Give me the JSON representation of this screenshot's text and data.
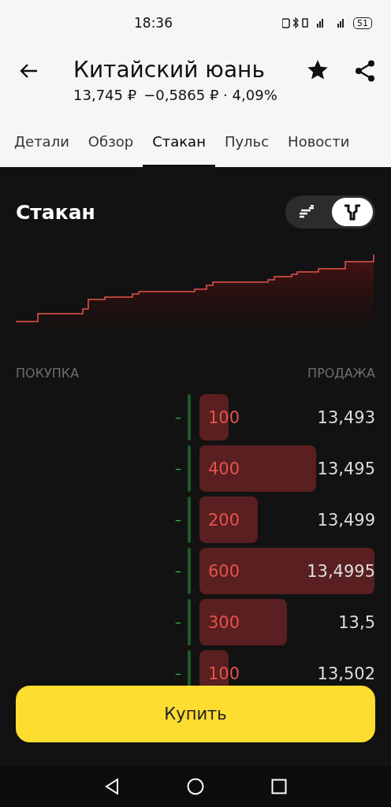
{
  "status_bar": {
    "time": "18:36",
    "battery": "51"
  },
  "header": {
    "title": "Китайский юань",
    "price": "13,745 ₽",
    "change": "−0,5865 ₽ · 4,09%",
    "favorite": true
  },
  "tabs": [
    {
      "label": "Детали",
      "selected": false
    },
    {
      "label": "Обзор",
      "selected": false
    },
    {
      "label": "Стакан",
      "selected": true
    },
    {
      "label": "Пульс",
      "selected": false
    },
    {
      "label": "Новости",
      "selected": false
    }
  ],
  "book": {
    "title": "Стакан",
    "view_toggle": [
      {
        "selected": false
      },
      {
        "selected": true
      }
    ],
    "buy_label": "ПОКУПКА",
    "sell_label": "ПРОДАЖА",
    "rows": [
      {
        "bid": "–",
        "qty": "100",
        "price": "13,493"
      },
      {
        "bid": "–",
        "qty": "400",
        "price": "13,495"
      },
      {
        "bid": "–",
        "qty": "200",
        "price": "13,499"
      },
      {
        "bid": "–",
        "qty": "600",
        "price": "13,4995"
      },
      {
        "bid": "–",
        "qty": "300",
        "price": "13,5"
      },
      {
        "bid": "–",
        "qty": "100",
        "price": "13,502"
      }
    ]
  },
  "buy_button": "Купить"
}
